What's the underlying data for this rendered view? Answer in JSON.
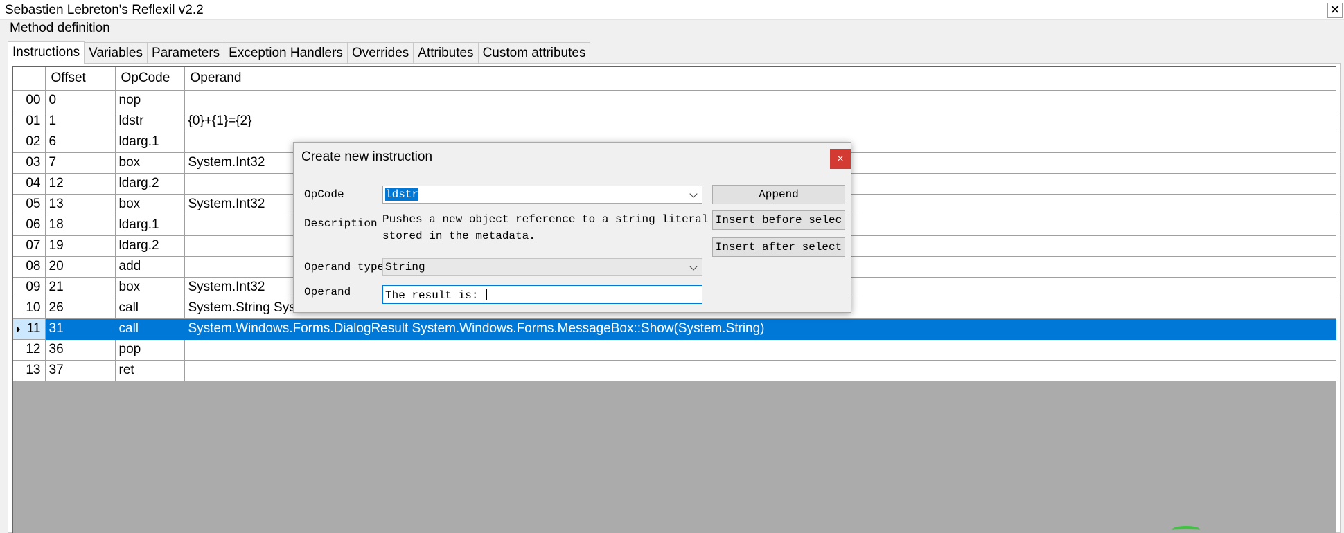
{
  "window": {
    "title": "Sebastien Lebreton's Reflexil v2.2",
    "close_glyph": "✕"
  },
  "group_label": "Method definition",
  "tabs": [
    {
      "label": "Instructions",
      "active": true
    },
    {
      "label": "Variables"
    },
    {
      "label": "Parameters"
    },
    {
      "label": "Exception Handlers"
    },
    {
      "label": "Overrides"
    },
    {
      "label": "Attributes"
    },
    {
      "label": "Custom attributes"
    }
  ],
  "grid": {
    "headers": {
      "offset": "Offset",
      "opcode": "OpCode",
      "operand": "Operand"
    },
    "rows": [
      {
        "index": "00",
        "offset": "0",
        "opcode": "nop",
        "operand": ""
      },
      {
        "index": "01",
        "offset": "1",
        "opcode": "ldstr",
        "operand": "{0}+{1}={2}"
      },
      {
        "index": "02",
        "offset": "6",
        "opcode": "ldarg.1",
        "operand": ""
      },
      {
        "index": "03",
        "offset": "7",
        "opcode": "box",
        "operand": "System.Int32"
      },
      {
        "index": "04",
        "offset": "12",
        "opcode": "ldarg.2",
        "operand": ""
      },
      {
        "index": "05",
        "offset": "13",
        "opcode": "box",
        "operand": "System.Int32"
      },
      {
        "index": "06",
        "offset": "18",
        "opcode": "ldarg.1",
        "operand": ""
      },
      {
        "index": "07",
        "offset": "19",
        "opcode": "ldarg.2",
        "operand": ""
      },
      {
        "index": "08",
        "offset": "20",
        "opcode": "add",
        "operand": ""
      },
      {
        "index": "09",
        "offset": "21",
        "opcode": "box",
        "operand": "System.Int32"
      },
      {
        "index": "10",
        "offset": "26",
        "opcode": "call",
        "operand": "System.String Syst"
      },
      {
        "index": "11",
        "offset": "31",
        "opcode": "call",
        "operand": "System.Windows.Forms.DialogResult System.Windows.Forms.MessageBox::Show(System.String)",
        "selected": true
      },
      {
        "index": "12",
        "offset": "36",
        "opcode": "pop",
        "operand": ""
      },
      {
        "index": "13",
        "offset": "37",
        "opcode": "ret",
        "operand": ""
      }
    ]
  },
  "dialog": {
    "title": "Create new instruction",
    "close_glyph": "×",
    "opcode_label": "OpCode",
    "opcode_value": "ldstr",
    "description_label": "Description",
    "description_line1": "Pushes a new object reference to a string literal",
    "description_line2": "stored in the metadata.",
    "operand_type_label": "Operand type",
    "operand_type_value": "String",
    "operand_label": "Operand",
    "operand_value": "The result is: ",
    "append_label": "Append",
    "insert_before_label": "Insert before selec",
    "insert_after_label": "Insert after select"
  },
  "colors": {
    "selection": "#0078d7",
    "close_red": "#d33a32",
    "grid_background": "#ababab"
  }
}
